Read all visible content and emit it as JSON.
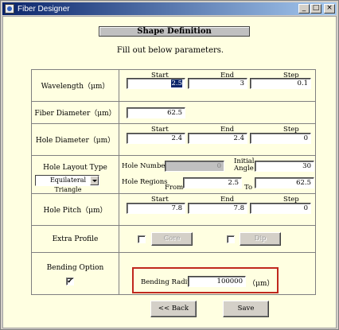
{
  "window": {
    "title": "Fiber Designer",
    "buttons": {
      "minimize": "_",
      "maximize": "□",
      "close": "×"
    }
  },
  "header": {
    "title": "Shape Definition",
    "instructions": "Fill out below parameters."
  },
  "wavelength": {
    "label": "Wavelength（μm）",
    "col_start": "Start",
    "col_end": "End",
    "col_step": "Step",
    "start": "2.5",
    "end": "3",
    "step": "0.1"
  },
  "fiber_diameter": {
    "label": "Fiber Diameter（μm）",
    "value": "62.5"
  },
  "hole_diameter": {
    "label": "Hole Diameter（μm）",
    "col_start": "Start",
    "col_end": "End",
    "col_step": "Step",
    "start": "2.4",
    "end": "2.4",
    "step": "0"
  },
  "hole_layout": {
    "label": "Hole Layout Type",
    "type_value": "Equilateral Triangle",
    "hole_numbers_label": "Hole Numbers",
    "hole_numbers_value": "0",
    "initial_angle_label_1": "Initial",
    "initial_angle_label_2": "Angle",
    "initial_angle_value": "30",
    "hole_regions_label": "Hole Regions",
    "from_label": "From",
    "from_value": "2.5",
    "to_label": "To",
    "to_value": "62.5"
  },
  "hole_pitch": {
    "label": "Hole Pitch（μm）",
    "col_start": "Start",
    "col_end": "End",
    "col_step": "Step",
    "start": "7.8",
    "end": "7.8",
    "step": "0"
  },
  "extra_profile": {
    "label": "Extra Profile",
    "core_label": "Core",
    "dip_label": "Dip",
    "core_checked": "",
    "dip_checked": ""
  },
  "bending": {
    "label": "Bending Option",
    "checked": "✔",
    "radius_label": "Bending Radius",
    "radius_value": "100000",
    "unit": "（μm）",
    "highlight_color": "#c0281e"
  },
  "footer": {
    "back_label": "<< Back",
    "save_label": "Save"
  }
}
